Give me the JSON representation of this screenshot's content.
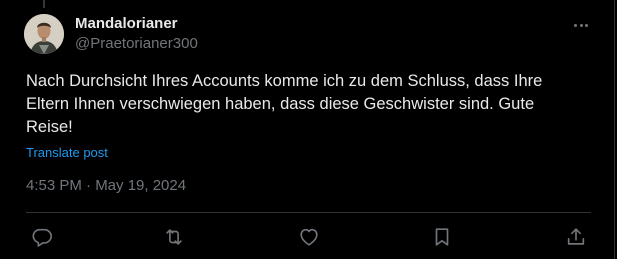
{
  "author": {
    "display_name": "Mandalorianer",
    "handle": "@Praetorianer300"
  },
  "post": {
    "text": "Nach Durchsicht Ihres Accounts komme ich zu dem Schluss, dass Ihre Eltern Ihnen verschwiegen haben, dass diese Geschwister sind. Gute Reise!",
    "translate_label": "Translate post",
    "timestamp": "4:53 PM · May 19, 2024"
  },
  "actions": [
    "reply-icon",
    "repost-icon",
    "like-icon",
    "bookmark-icon",
    "share-icon"
  ],
  "colors": {
    "background": "#000000",
    "text": "#e7e9ea",
    "muted": "#71767b",
    "link": "#1d9bf0",
    "border": "#2f3336"
  }
}
